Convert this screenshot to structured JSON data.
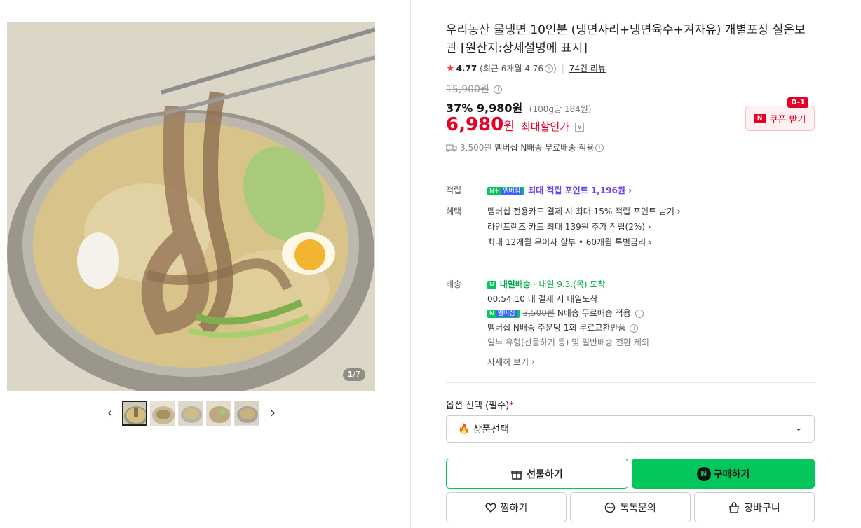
{
  "gallery": {
    "counter_current": "1",
    "counter_sep": "/",
    "counter_total": "7",
    "prev_arrow": "‹",
    "next_arrow": "›"
  },
  "product": {
    "title": "우리농산 물냉면 10인분 (냉면사리+냉면육수+겨자유) 개별포장 실온보관 [원산지:상세설명에 표시]",
    "rating": "4.77",
    "rating_recent": "(최근 6개월 4.76",
    "rating_recent_close": ")",
    "review_count": "74건 리뷰",
    "original_price": "15,900원",
    "discount_rate": "37%",
    "sale_price": "9,980원",
    "unit_price": "(100g당 184원)",
    "max_discount_price": "6,980",
    "max_discount_won": "원",
    "max_discount_label": "최대할인가",
    "coupon_label": "쿠폰 받기",
    "coupon_badge": "D-1",
    "coupon_logo": "N",
    "shipping_old": "3,500원",
    "shipping_text": "멤버십 N배송 무료배송 적용"
  },
  "points": {
    "label": "적립",
    "membership_badge": "N",
    "membership_plus": "+",
    "membership_text": "멤버십",
    "max_points": "최대 적립 포인트 1,196원 ›"
  },
  "benefits": {
    "label": "혜택",
    "items": [
      "멤버십 전용카드 결제 시 최대 15% 적립 포인트 받기 ›",
      "라인프렌즈 카드 최대 139원 추가 적립(2%) ›",
      "최대 12개월 무이자 할부 • 60개월 특별금리 ›"
    ]
  },
  "delivery": {
    "label": "배송",
    "badge": "N",
    "badge_text": "내일배송",
    "arrival": "· 내일 9.3.(목) 도착",
    "countdown": "00:54:10  내 결제 시 내일도착",
    "member_badge": "N",
    "member_text": "멤버십",
    "old_fee": "3,500원",
    "free_text": "N배송 무료배송 적용",
    "exchange": "멤버십 N배송 주문당 1회 무료교환반품",
    "exclude": "일부 유형(선물하기 등) 및 일반배송 전환 제외",
    "detail_link": "자세히 보기 ›"
  },
  "options": {
    "label": "옵션 선택 (필수)",
    "required_mark": "*",
    "select_value": "상품선택"
  },
  "actions": {
    "gift": "선물하기",
    "buy": "구매하기",
    "buy_icon": "N",
    "wish": "찜하기",
    "talk": "톡톡문의",
    "cart": "장바구니"
  },
  "icons": {
    "star": "★",
    "info": "i",
    "caret": "∨",
    "flame": "🔥",
    "chevron": "⌄"
  },
  "colors": {
    "accent_green": "#03c75a",
    "sale_red": "#e60023",
    "points_purple": "#6a3ff0"
  }
}
